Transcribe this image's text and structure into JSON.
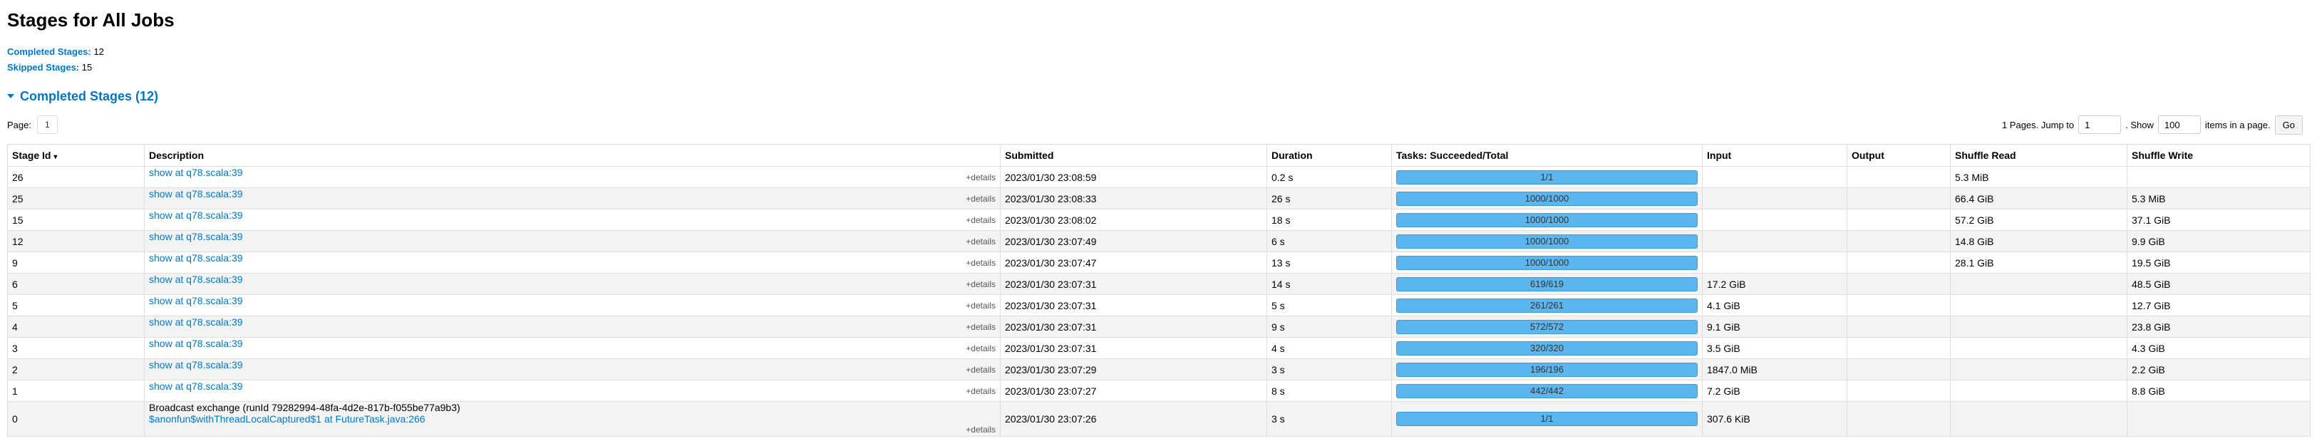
{
  "title": "Stages for All Jobs",
  "summary": {
    "completed_label": "Completed Stages:",
    "completed_value": "12",
    "skipped_label": "Skipped Stages:",
    "skipped_value": "15"
  },
  "section": {
    "label": "Completed Stages (12)"
  },
  "pager": {
    "page_label": "Page:",
    "page_value": "1",
    "pages_text": "1 Pages. Jump to",
    "jump_value": "1",
    "show_text": ". Show",
    "show_value": "100",
    "items_text": "items in a page.",
    "go_label": "Go"
  },
  "columns": [
    "Stage Id",
    "Description",
    "Submitted",
    "Duration",
    "Tasks: Succeeded/Total",
    "Input",
    "Output",
    "Shuffle Read",
    "Shuffle Write"
  ],
  "sort_icon": "▾",
  "details_label": "+details",
  "rows": [
    {
      "id": "26",
      "desc": "show at q78.scala:39",
      "submitted": "2023/01/30 23:08:59",
      "duration": "0.2 s",
      "tasks": "1/1",
      "progress": 1.0,
      "input": "",
      "output": "",
      "shuffle_read": "5.3 MiB",
      "shuffle_write": ""
    },
    {
      "id": "25",
      "desc": "show at q78.scala:39",
      "submitted": "2023/01/30 23:08:33",
      "duration": "26 s",
      "tasks": "1000/1000",
      "progress": 1.0,
      "input": "",
      "output": "",
      "shuffle_read": "66.4 GiB",
      "shuffle_write": "5.3 MiB"
    },
    {
      "id": "15",
      "desc": "show at q78.scala:39",
      "submitted": "2023/01/30 23:08:02",
      "duration": "18 s",
      "tasks": "1000/1000",
      "progress": 1.0,
      "input": "",
      "output": "",
      "shuffle_read": "57.2 GiB",
      "shuffle_write": "37.1 GiB"
    },
    {
      "id": "12",
      "desc": "show at q78.scala:39",
      "submitted": "2023/01/30 23:07:49",
      "duration": "6 s",
      "tasks": "1000/1000",
      "progress": 1.0,
      "input": "",
      "output": "",
      "shuffle_read": "14.8 GiB",
      "shuffle_write": "9.9 GiB"
    },
    {
      "id": "9",
      "desc": "show at q78.scala:39",
      "submitted": "2023/01/30 23:07:47",
      "duration": "13 s",
      "tasks": "1000/1000",
      "progress": 1.0,
      "input": "",
      "output": "",
      "shuffle_read": "28.1 GiB",
      "shuffle_write": "19.5 GiB"
    },
    {
      "id": "6",
      "desc": "show at q78.scala:39",
      "submitted": "2023/01/30 23:07:31",
      "duration": "14 s",
      "tasks": "619/619",
      "progress": 1.0,
      "input": "17.2 GiB",
      "output": "",
      "shuffle_read": "",
      "shuffle_write": "48.5 GiB"
    },
    {
      "id": "5",
      "desc": "show at q78.scala:39",
      "submitted": "2023/01/30 23:07:31",
      "duration": "5 s",
      "tasks": "261/261",
      "progress": 1.0,
      "input": "4.1 GiB",
      "output": "",
      "shuffle_read": "",
      "shuffle_write": "12.7 GiB"
    },
    {
      "id": "4",
      "desc": "show at q78.scala:39",
      "submitted": "2023/01/30 23:07:31",
      "duration": "9 s",
      "tasks": "572/572",
      "progress": 1.0,
      "input": "9.1 GiB",
      "output": "",
      "shuffle_read": "",
      "shuffle_write": "23.8 GiB"
    },
    {
      "id": "3",
      "desc": "show at q78.scala:39",
      "submitted": "2023/01/30 23:07:31",
      "duration": "4 s",
      "tasks": "320/320",
      "progress": 1.0,
      "input": "3.5 GiB",
      "output": "",
      "shuffle_read": "",
      "shuffle_write": "4.3 GiB"
    },
    {
      "id": "2",
      "desc": "show at q78.scala:39",
      "submitted": "2023/01/30 23:07:29",
      "duration": "3 s",
      "tasks": "196/196",
      "progress": 1.0,
      "input": "1847.0 MiB",
      "output": "",
      "shuffle_read": "",
      "shuffle_write": "2.2 GiB"
    },
    {
      "id": "1",
      "desc": "show at q78.scala:39",
      "submitted": "2023/01/30 23:07:27",
      "duration": "8 s",
      "tasks": "442/442",
      "progress": 1.0,
      "input": "7.2 GiB",
      "output": "",
      "shuffle_read": "",
      "shuffle_write": "8.8 GiB"
    },
    {
      "id": "0",
      "desc_text": "Broadcast exchange (runId 79282994-48fa-4d2e-817b-f055be77a9b3)",
      "desc": "$anonfun$withThreadLocalCaptured$1 at FutureTask.java:266",
      "submitted": "2023/01/30 23:07:26",
      "duration": "3 s",
      "tasks": "1/1",
      "progress": 1.0,
      "input": "307.6 KiB",
      "output": "",
      "shuffle_read": "",
      "shuffle_write": ""
    }
  ]
}
